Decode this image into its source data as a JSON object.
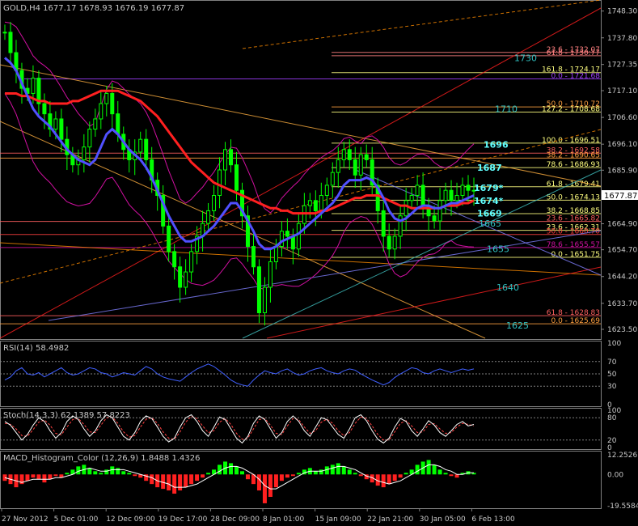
{
  "window": {
    "symbol_line": "GOLD,H4  1677.17 1678.93 1676.19 1677.87",
    "current_price": "1677.87"
  },
  "colors": {
    "background": "#000000",
    "axis_text": "#c8c8c8",
    "grid": "#5a5a5a",
    "candle": "#00ff00",
    "ma_slow": "#ff2020",
    "ma_fast": "#5050ff",
    "bollinger": "#d010a0",
    "fib": "#ffff80",
    "level_label": "#30c0c0",
    "level_label_bold": "#60ffff",
    "rsi_line": "#4060ff",
    "stoch_main": "#ffffff",
    "stoch_signal": "#ff4040",
    "macd_up": "#00ff00",
    "macd_down": "#ff2020"
  },
  "chart_data": [
    {
      "type": "candlestick",
      "panel": "main",
      "symbol": "GOLD",
      "timeframe": "H4",
      "ohlc_last": {
        "open": 1677.17,
        "high": 1678.93,
        "low": 1676.19,
        "close": 1677.87
      },
      "y_ticks": [
        1748.3,
        1737.8,
        1727.35,
        1717.1,
        1706.6,
        1696.1,
        1685.9,
        1675.45,
        1664.9,
        1654.7,
        1644.2,
        1633.7,
        1623.5
      ],
      "x_ticks": [
        "27 Nov 2012",
        "5 Dec 01:00",
        "12 Dec 09:00",
        "19 Dec 17:00",
        "28 Dec 09:00",
        "8 Jan 01:00",
        "15 Jan 09:00",
        "22 Jan 21:00",
        "30 Jan 05:00",
        "6 Feb 13:00"
      ],
      "ylim": [
        1620,
        1752
      ],
      "close_path": [
        1740,
        1732,
        1725,
        1718,
        1716,
        1722,
        1712,
        1708,
        1702,
        1706,
        1698,
        1692,
        1688,
        1690,
        1695,
        1702,
        1706,
        1712,
        1716,
        1708,
        1700,
        1694,
        1690,
        1693,
        1698,
        1690,
        1682,
        1676,
        1664,
        1654,
        1648,
        1640,
        1646,
        1654,
        1660,
        1665,
        1670,
        1676,
        1686,
        1694,
        1688,
        1678,
        1668,
        1656,
        1648,
        1630,
        1640,
        1650,
        1656,
        1662,
        1660,
        1655,
        1665,
        1672,
        1674,
        1670,
        1676,
        1680,
        1685,
        1690,
        1694,
        1690,
        1684,
        1692,
        1690,
        1680,
        1670,
        1660,
        1655,
        1660,
        1668,
        1674,
        1676,
        1680,
        1672,
        1668,
        1666,
        1674,
        1678,
        1674,
        1676,
        1680,
        1678,
        1678
      ],
      "ma_fast": [
        1730,
        1728,
        1725,
        1720,
        1715,
        1710,
        1707,
        1705,
        1703,
        1700,
        1697,
        1694,
        1692,
        1690,
        1689,
        1688,
        1690,
        1695,
        1700,
        1702,
        1700,
        1697,
        1694,
        1692,
        1690,
        1687,
        1683,
        1678,
        1673,
        1668,
        1664,
        1660,
        1658,
        1658,
        1659,
        1660,
        1662,
        1664,
        1667,
        1670,
        1673,
        1673,
        1670,
        1666,
        1662,
        1657,
        1655,
        1655,
        1656,
        1658,
        1659,
        1660,
        1661,
        1663,
        1665,
        1667,
        1669,
        1671,
        1673,
        1676,
        1680,
        1682,
        1682,
        1682,
        1683,
        1682,
        1679,
        1675,
        1670,
        1667,
        1666,
        1667,
        1669,
        1671,
        1672,
        1672,
        1671,
        1671,
        1672,
        1673,
        1673,
        1674,
        1675,
        1676
      ],
      "ma_slow": [
        1716,
        1716,
        1716,
        1715,
        1715,
        1714,
        1713,
        1713,
        1712,
        1712,
        1712,
        1712,
        1713,
        1713,
        1714,
        1715,
        1716,
        1717,
        1717,
        1717,
        1717,
        1716,
        1715,
        1714,
        1713,
        1711,
        1709,
        1707,
        1704,
        1701,
        1698,
        1695,
        1692,
        1689,
        1687,
        1685,
        1683,
        1681,
        1680,
        1679,
        1678,
        1677,
        1676,
        1675,
        1674,
        1673,
        1672,
        1671,
        1671,
        1670,
        1670,
        1669,
        1669,
        1669,
        1669,
        1669,
        1670,
        1670,
        1671,
        1672,
        1673,
        1674,
        1675,
        1675,
        1676,
        1676,
        1676,
        1675,
        1674,
        1673,
        1672,
        1672,
        1671,
        1671,
        1671,
        1671,
        1671,
        1671,
        1672,
        1672,
        1672,
        1673,
        1673,
        1674
      ],
      "fib_levels": [
        {
          "text": "23.6 - 1732.07"
        },
        {
          "text": "61.8 - 1730.77"
        },
        {
          "text": "161.8 - 1724.17"
        },
        {
          "text": "0.0 - 1721.68"
        },
        {
          "text": "50.0 - 1710.72"
        },
        {
          "text": "127.2 - 1708.68"
        },
        {
          "text": "100.0 - 1696.51"
        },
        {
          "text": "38.2 - 1692.58"
        },
        {
          "text": "38.2 - 1690.65"
        },
        {
          "text": "78.6 - 1686.93"
        },
        {
          "text": "61.8 - 1679.41"
        },
        {
          "text": "50.0 - 1674.13"
        },
        {
          "text": "38.2 - 1668.85"
        },
        {
          "text": "23.6 - 1665.82"
        },
        {
          "text": "23.6 - 1662.31"
        },
        {
          "text": "50.0 - 1660.70"
        },
        {
          "text": "78.6 - 1655.57"
        },
        {
          "text": "0.0 - 1651.75"
        },
        {
          "text": "61.8 - 1628.83"
        },
        {
          "text": "0.0 - 1625.69"
        }
      ],
      "level_labels": [
        {
          "text": "1730"
        },
        {
          "text": "1710"
        },
        {
          "text": "1696"
        },
        {
          "text": "1687"
        },
        {
          "text": "1679*"
        },
        {
          "text": "1674*"
        },
        {
          "text": "1669"
        },
        {
          "text": "1665"
        },
        {
          "text": "1655"
        },
        {
          "text": "1640"
        },
        {
          "text": "1625"
        }
      ]
    },
    {
      "type": "line",
      "panel": "rsi",
      "title": "RSI(14) 58.4982",
      "y_ticks": [
        100,
        70,
        50,
        30,
        0
      ],
      "levels": [
        70,
        50,
        30
      ],
      "ylim": [
        0,
        100
      ],
      "values": [
        40,
        45,
        55,
        60,
        50,
        48,
        52,
        45,
        50,
        55,
        60,
        52,
        48,
        50,
        55,
        60,
        58,
        52,
        50,
        45,
        48,
        52,
        50,
        48,
        55,
        62,
        58,
        50,
        45,
        42,
        40,
        38,
        45,
        52,
        58,
        62,
        66,
        62,
        55,
        48,
        40,
        35,
        32,
        30,
        40,
        48,
        55,
        52,
        50,
        55,
        58,
        52,
        48,
        50,
        55,
        58,
        60,
        55,
        52,
        50,
        55,
        58,
        56,
        50,
        45,
        40,
        36,
        32,
        36,
        44,
        50,
        55,
        60,
        58,
        52,
        50,
        55,
        58,
        55,
        52,
        55,
        58,
        56,
        58
      ]
    },
    {
      "type": "line",
      "panel": "stochastic",
      "title": "Stoch(14,3,3) 62.1389 57.8223",
      "y_ticks": [
        100,
        80,
        20,
        0
      ],
      "levels": [
        80,
        20
      ],
      "ylim": [
        0,
        100
      ],
      "main": [
        70,
        60,
        40,
        20,
        35,
        60,
        80,
        70,
        45,
        25,
        40,
        70,
        85,
        75,
        50,
        30,
        45,
        72,
        88,
        80,
        55,
        30,
        20,
        40,
        70,
        85,
        78,
        55,
        30,
        15,
        25,
        55,
        80,
        88,
        70,
        45,
        30,
        55,
        82,
        75,
        50,
        25,
        12,
        30,
        65,
        85,
        75,
        50,
        25,
        40,
        70,
        85,
        70,
        45,
        30,
        55,
        80,
        75,
        55,
        35,
        25,
        50,
        80,
        88,
        72,
        45,
        22,
        12,
        25,
        55,
        78,
        70,
        45,
        30,
        50,
        72,
        60,
        40,
        30,
        45,
        62,
        70,
        58,
        62
      ],
      "signal": [
        65,
        62,
        50,
        32,
        30,
        48,
        68,
        74,
        60,
        38,
        34,
        55,
        75,
        78,
        62,
        42,
        40,
        60,
        80,
        82,
        65,
        42,
        28,
        32,
        55,
        76,
        80,
        65,
        42,
        25,
        22,
        42,
        68,
        84,
        78,
        58,
        40,
        45,
        68,
        78,
        62,
        38,
        22,
        25,
        50,
        75,
        78,
        60,
        38,
        35,
        58,
        78,
        75,
        55,
        38,
        45,
        68,
        76,
        65,
        45,
        32,
        40,
        65,
        82,
        78,
        58,
        35,
        20,
        20,
        42,
        65,
        72,
        58,
        40,
        42,
        62,
        64,
        50,
        38,
        40,
        55,
        65,
        62,
        58
      ]
    },
    {
      "type": "bar",
      "panel": "macd",
      "title": "MACD_Histogram_Color (12,26,9)  1.8488  1.4326",
      "y_ticks": [
        12.2526,
        0.0,
        -19.5584
      ],
      "ylim": [
        -19.5584,
        12.2526
      ],
      "values": [
        -4,
        -6,
        -8,
        -6,
        -4,
        -2,
        -3,
        -5,
        -3,
        -1,
        -2,
        1,
        3,
        5,
        6,
        4,
        2,
        1,
        3,
        5,
        4,
        2,
        1,
        -1,
        -2,
        -4,
        -6,
        -8,
        -9,
        -10,
        -12,
        -10,
        -8,
        -6,
        -4,
        -2,
        1,
        3,
        6,
        8,
        7,
        5,
        2,
        -3,
        -6,
        -10,
        -18,
        -14,
        -8,
        -4,
        -2,
        -1,
        1,
        3,
        4,
        2,
        3,
        5,
        6,
        7,
        5,
        3,
        1,
        -1,
        -3,
        -5,
        -7,
        -8,
        -6,
        -4,
        -2,
        1,
        3,
        6,
        8,
        9,
        6,
        3,
        1,
        -1,
        -2,
        1,
        2,
        1
      ],
      "signal": [
        -2,
        -3,
        -4,
        -5,
        -4,
        -3,
        -3,
        -3,
        -3,
        -2,
        -2,
        -1,
        0,
        2,
        3,
        4,
        3,
        2,
        2,
        3,
        3,
        3,
        2,
        1,
        0,
        -1,
        -2,
        -4,
        -5,
        -6,
        -8,
        -8,
        -8,
        -7,
        -6,
        -4,
        -2,
        0,
        2,
        4,
        5,
        5,
        4,
        2,
        0,
        -3,
        -7,
        -9,
        -9,
        -7,
        -5,
        -3,
        -1,
        1,
        2,
        2,
        2,
        3,
        4,
        5,
        5,
        4,
        3,
        1,
        -1,
        -2,
        -4,
        -5,
        -6,
        -5,
        -4,
        -2,
        0,
        2,
        4,
        6,
        6,
        5,
        3,
        2,
        0,
        0,
        1,
        1
      ]
    }
  ]
}
